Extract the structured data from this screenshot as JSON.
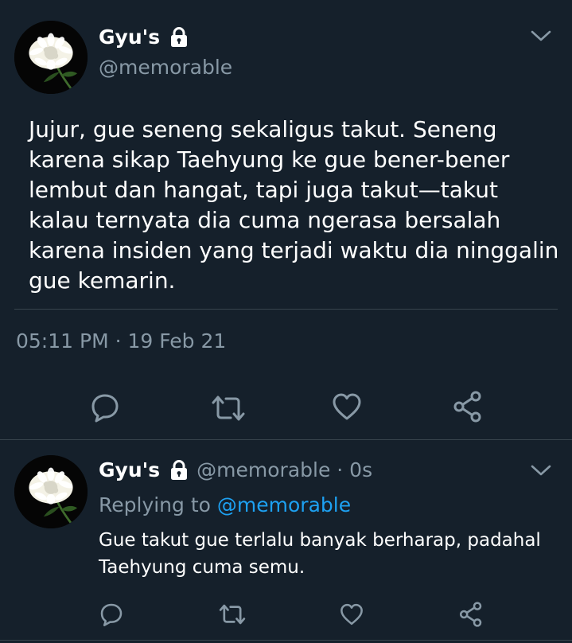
{
  "tweet": {
    "display_name": "Gyu's",
    "handle": "@memorable",
    "text": "Jujur, gue seneng sekaligus takut. Seneng karena sikap Taehyung ke gue bener-bener lembut dan hangat, tapi juga takut—takut kalau ternyata dia cuma ngerasa bersalah karena insiden yang terjadi waktu dia ninggalin gue kemarin.",
    "timestamp": "05:11 PM · 19 Feb 21",
    "avatar": "white-chrysanthemum-flower",
    "locked_icon": "lock-icon"
  },
  "actions": [
    "reply-icon",
    "retweet-icon",
    "like-icon",
    "share-icon"
  ],
  "reply": {
    "display_name": "Gyu's",
    "handle_time": "@memorable · 0s",
    "replying_prefix": "Replying to",
    "replying_to": "@memorable",
    "text": "Gue takut gue terlalu banyak berharap, padahal Taehyung cuma semu."
  },
  "colors": {
    "background": "#15202b",
    "secondary_text": "#8899a6",
    "accent": "#1da1f2",
    "divider": "#38444d"
  }
}
